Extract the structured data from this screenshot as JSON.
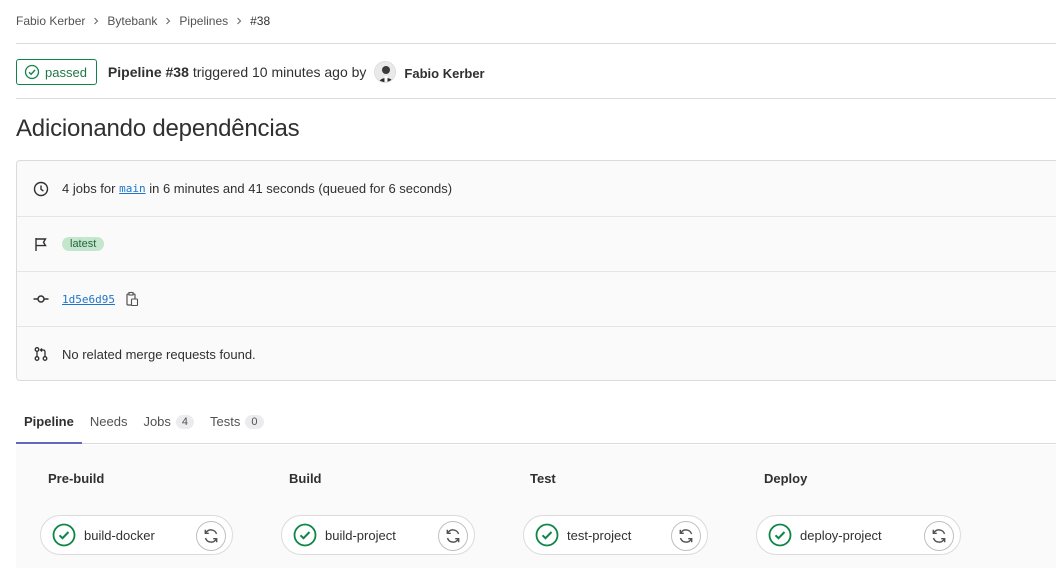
{
  "breadcrumb": [
    "Fabio Kerber",
    "Bytebank",
    "Pipelines",
    "#38"
  ],
  "status": {
    "label": "passed",
    "color": "#108548"
  },
  "header": {
    "pipeline_label": "Pipeline #38",
    "triggered_text": "triggered 10 minutes ago by",
    "author": "Fabio Kerber"
  },
  "title": "Adicionando dependências",
  "info": {
    "duration": {
      "prefix": "4 jobs for",
      "branch": "main",
      "suffix": "in 6 minutes and 41 seconds (queued for 6 seconds)"
    },
    "tag": "latest",
    "commit_sha": "1d5e6d95",
    "merge_requests": "No related merge requests found."
  },
  "tabs": [
    {
      "label": "Pipeline",
      "count": null,
      "active": true
    },
    {
      "label": "Needs",
      "count": null,
      "active": false
    },
    {
      "label": "Jobs",
      "count": "4",
      "active": false
    },
    {
      "label": "Tests",
      "count": "0",
      "active": false
    }
  ],
  "stages": [
    {
      "title": "Pre-build",
      "job": "build-docker",
      "status": "success"
    },
    {
      "title": "Build",
      "job": "build-project",
      "status": "success"
    },
    {
      "title": "Test",
      "job": "test-project",
      "status": "success"
    },
    {
      "title": "Deploy",
      "job": "deploy-project",
      "status": "success"
    }
  ],
  "icons": {
    "status": "check-circle-icon",
    "duration": "clock-icon",
    "tag": "flag-icon",
    "commit": "commit-icon",
    "merge": "merge-request-icon",
    "copy": "copy-icon",
    "retry": "retry-icon"
  }
}
